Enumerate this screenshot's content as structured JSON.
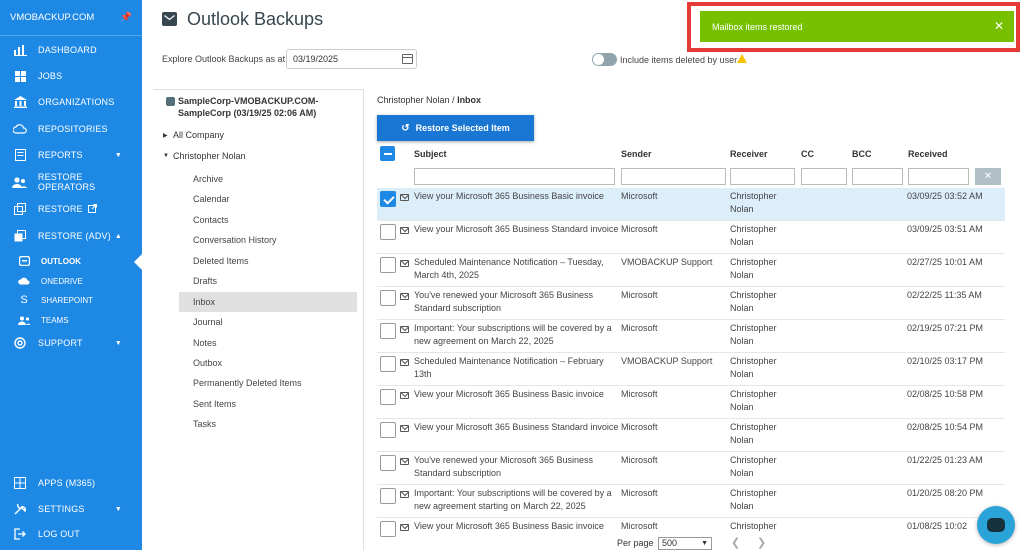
{
  "sidebar": {
    "brand": "VMOBACKUP.COM",
    "items": [
      {
        "label": "DASHBOARD",
        "icon": "bar-chart-icon"
      },
      {
        "label": "JOBS",
        "icon": "windows-grid-icon"
      },
      {
        "label": "ORGANIZATIONS",
        "icon": "bank-icon"
      },
      {
        "label": "REPOSITORIES",
        "icon": "cloud-icon"
      },
      {
        "label": "REPORTS",
        "icon": "report-icon"
      },
      {
        "label": "RESTORE OPERATORS",
        "icon": "users-icon"
      },
      {
        "label": "RESTORE",
        "icon": "restore-icon"
      },
      {
        "label": "RESTORE (ADV)",
        "icon": "restore-adv-icon"
      }
    ],
    "subitems": [
      {
        "label": "OUTLOOK",
        "icon": "outlook-icon"
      },
      {
        "label": "ONEDRIVE",
        "icon": "onedrive-icon"
      },
      {
        "label": "SHAREPOINT",
        "icon": "sharepoint-icon"
      },
      {
        "label": "TEAMS",
        "icon": "teams-icon"
      }
    ],
    "support": "SUPPORT",
    "bottom": [
      {
        "label": "APPS (M365)",
        "icon": "apps-icon"
      },
      {
        "label": "SETTINGS",
        "icon": "settings-icon"
      },
      {
        "label": "LOG OUT",
        "icon": "logout-icon"
      }
    ]
  },
  "header": {
    "title": "Outlook Backups",
    "explore_label": "Explore Outlook Backups as at",
    "date_value": "03/19/2025",
    "toggle_label": "Include items deleted by user"
  },
  "toast": {
    "message": "Mailbox items restored",
    "close": "✕"
  },
  "tree": {
    "root_line1": "SampleCorp-VMOBACKUP.COM-",
    "root_line2": "SampleCorp (03/19/25 02:06 AM)",
    "all_company": "All Company",
    "user": "Christopher Nolan",
    "folders": [
      "Archive",
      "Calendar",
      "Contacts",
      "Conversation History",
      "Deleted Items",
      "Drafts",
      "Inbox",
      "Journal",
      "Notes",
      "Outbox",
      "Permanently Deleted Items",
      "Sent Items",
      "Tasks"
    ]
  },
  "breadcrumb": {
    "user": "Christopher Nolan",
    "sep": " / ",
    "folder": "Inbox"
  },
  "restore_button": "Restore Selected Item",
  "table": {
    "headers": [
      "Subject",
      "Sender",
      "Receiver",
      "CC",
      "BCC",
      "Received"
    ],
    "rows": [
      {
        "subject": "View your Microsoft 365 Business Basic invoice",
        "sender": "Microsoft",
        "receiver": "Christopher Nolan",
        "received": "03/09/25 03:52 AM",
        "selected": true
      },
      {
        "subject": "View your Microsoft 365 Business Standard invoice",
        "sender": "Microsoft",
        "receiver": "Christopher Nolan",
        "received": "03/09/25 03:51 AM"
      },
      {
        "subject": "Scheduled Maintenance Notification – Tuesday, March 4th, 2025",
        "sender": "VMOBACKUP Support",
        "receiver": "Christopher Nolan",
        "received": "02/27/25 10:01 AM"
      },
      {
        "subject": "You've renewed your Microsoft 365 Business Standard subscription",
        "sender": "Microsoft",
        "receiver": "Christopher Nolan",
        "received": "02/22/25 11:35 AM"
      },
      {
        "subject": "Important: Your subscriptions will be covered by a new agreement on March 22, 2025",
        "sender": "Microsoft",
        "receiver": "Christopher Nolan",
        "received": "02/19/25 07:21 PM"
      },
      {
        "subject": "Scheduled Maintenance Notification – February 13th",
        "sender": "VMOBACKUP Support",
        "receiver": "Christopher Nolan",
        "received": "02/10/25 03:17 PM"
      },
      {
        "subject": "View your Microsoft 365 Business Basic invoice",
        "sender": "Microsoft",
        "receiver": "Christopher Nolan",
        "received": "02/08/25 10:58 PM"
      },
      {
        "subject": "View your Microsoft 365 Business Standard invoice",
        "sender": "Microsoft",
        "receiver": "Christopher Nolan",
        "received": "02/08/25 10:54 PM"
      },
      {
        "subject": "You've renewed your Microsoft 365 Business Standard subscription",
        "sender": "Microsoft",
        "receiver": "Christopher Nolan",
        "received": "01/22/25 01:23 AM"
      },
      {
        "subject": "Important: Your subscriptions will be covered by a new agreement starting on March 22, 2025",
        "sender": "Microsoft",
        "receiver": "Christopher Nolan",
        "received": "01/20/25 08:20 PM"
      },
      {
        "subject": "View your Microsoft 365 Business Basic invoice",
        "sender": "Microsoft",
        "receiver": "Christopher",
        "received": "01/08/25 10:02"
      }
    ]
  },
  "pager": {
    "label": "Per page",
    "value": "500"
  },
  "colors": {
    "sidebar": "#1e88e5",
    "toast": "#76c000",
    "toast_frame": "#e53935",
    "primary_button": "#1976d2"
  }
}
